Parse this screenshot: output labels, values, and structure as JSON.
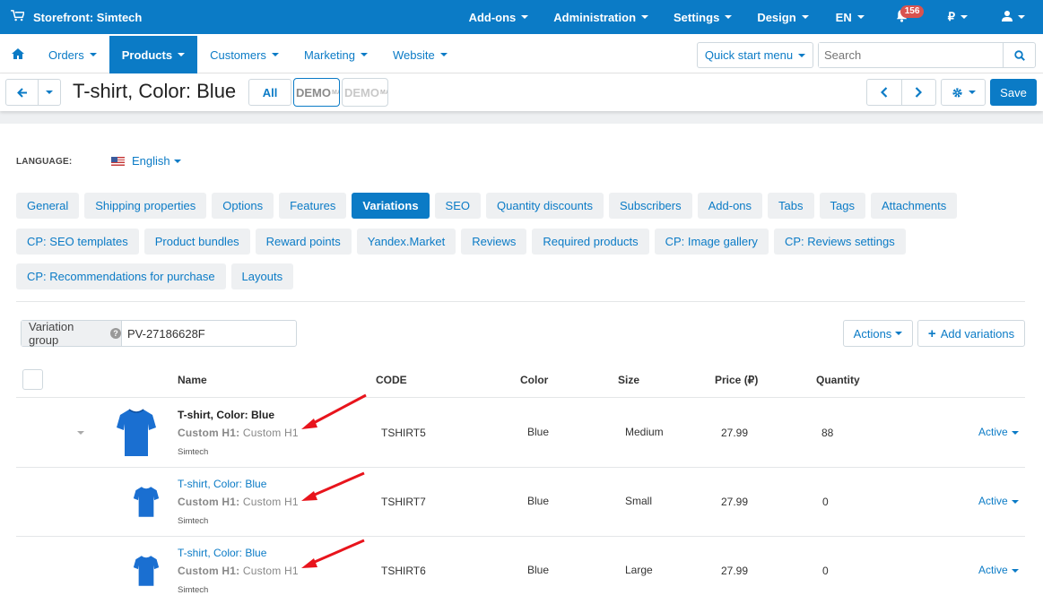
{
  "topbar": {
    "store_title": "Storefront: Simtech",
    "menu": [
      {
        "label": "Add-ons"
      },
      {
        "label": "Administration"
      },
      {
        "label": "Settings"
      },
      {
        "label": "Design"
      },
      {
        "label": "EN"
      }
    ],
    "notifications_count": "156",
    "currency": "₽",
    "bar_color": "#0b7bc6"
  },
  "subnav": {
    "items": [
      {
        "label": "Orders"
      },
      {
        "label": "Products"
      },
      {
        "label": "Customers"
      },
      {
        "label": "Marketing"
      },
      {
        "label": "Website"
      }
    ],
    "active": "Products",
    "quick_start": "Quick start menu",
    "search_placeholder": "Search"
  },
  "titlebar": {
    "title": "T-shirt, Color: Blue",
    "all_label": "All",
    "demo1_label": "DEMO",
    "demo1_small": "MA",
    "demo2_label": "DEMO",
    "demo2_small": "MA",
    "save_label": "Save"
  },
  "language": {
    "label": "LANGUAGE:",
    "value": "English"
  },
  "tabs": {
    "row1": [
      "General",
      "Shipping properties",
      "Options",
      "Features",
      "Variations",
      "SEO",
      "Quantity discounts",
      "Subscribers",
      "Add-ons",
      "Tabs",
      "Tags",
      "Attachments"
    ],
    "row2": [
      "CP: SEO templates",
      "Product bundles",
      "Reward points",
      "Yandex.Market",
      "Reviews",
      "Required products",
      "CP: Image gallery",
      "CP: Reviews settings"
    ],
    "row3": [
      "CP: Recommendations for purchase",
      "Layouts"
    ],
    "active": "Variations"
  },
  "variation_group": {
    "label": "Variation group",
    "value": "PV-27186628F",
    "actions_label": "Actions",
    "add_label": "Add variations"
  },
  "table": {
    "headers": {
      "name": "Name",
      "code": "CODE",
      "color": "Color",
      "size": "Size",
      "price": "Price (₽)",
      "quantity": "Quantity"
    },
    "rows": [
      {
        "name": "T-shirt, Color: Blue",
        "h1_label": "Custom H1:",
        "h1_value": "Custom H1",
        "vendor": "Simtech",
        "code": "TSHIRT5",
        "color": "Blue",
        "size": "Medium",
        "price": "27.99",
        "quantity": "88",
        "status": "Active"
      },
      {
        "name": "T-shirt, Color: Blue",
        "h1_label": "Custom H1:",
        "h1_value": "Custom H1",
        "vendor": "Simtech",
        "code": "TSHIRT7",
        "color": "Blue",
        "size": "Small",
        "price": "27.99",
        "quantity": "0",
        "status": "Active"
      },
      {
        "name": "T-shirt, Color: Blue",
        "h1_label": "Custom H1:",
        "h1_value": "Custom H1",
        "vendor": "Simtech",
        "code": "TSHIRT6",
        "color": "Blue",
        "size": "Large",
        "price": "27.99",
        "quantity": "0",
        "status": "Active"
      }
    ]
  },
  "colors": {
    "accent": "#0b7bc6",
    "badge": "#d9534f",
    "annotation_arrow": "#e8141c",
    "shirt": "#1a6fd1"
  }
}
